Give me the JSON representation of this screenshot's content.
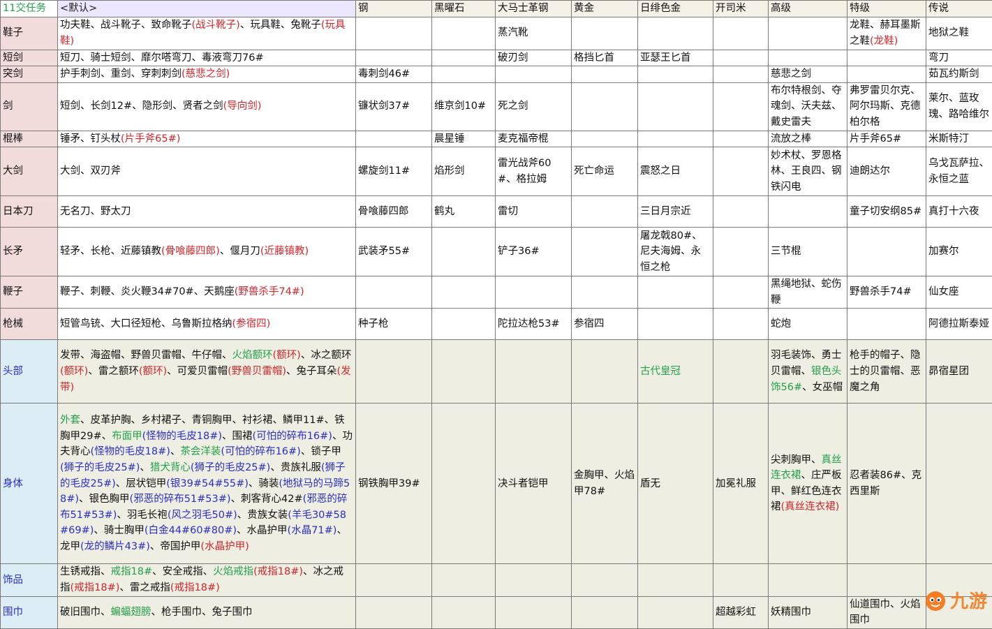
{
  "headers": [
    "11交任务",
    "<默认>",
    "钢",
    "黑曜石",
    "大马士革钢",
    "黄金",
    "日绯色金",
    "开司米",
    "高级",
    "特级",
    "传说"
  ],
  "rows": [
    {
      "label": "鞋子",
      "group": "weapon",
      "height": 47,
      "cells": [
        [
          {
            "t": "功夫鞋、战斗靴子、致命靴子"
          },
          {
            "t": "(战斗靴子)",
            "c": "red"
          },
          {
            "t": "、玩具鞋、兔靴子"
          },
          {
            "t": "(玩具鞋)",
            "c": "red"
          }
        ],
        [],
        [],
        [
          {
            "t": "蒸汽靴"
          }
        ],
        [],
        [],
        [],
        [],
        [
          {
            "t": "龙鞋、赫耳墨斯之鞋"
          },
          {
            "t": "(龙鞋)",
            "c": "red"
          }
        ],
        [
          {
            "t": "地狱之鞋"
          }
        ]
      ]
    },
    {
      "label": "短剑",
      "group": "weapon",
      "height": 23,
      "cells": [
        [
          {
            "t": "短刀、骑士短剑、靡尔嗒弯刀、毒液弯刀76#"
          }
        ],
        [],
        [],
        [
          {
            "t": "破刃剑"
          }
        ],
        [
          {
            "t": "格挡匕首"
          }
        ],
        [
          {
            "t": "亚瑟王匕首"
          }
        ],
        [],
        [],
        [],
        [
          {
            "t": "弯刀"
          }
        ]
      ]
    },
    {
      "label": "突剑",
      "group": "weapon",
      "height": 22,
      "cells": [
        [
          {
            "t": "护手刺剑、重剑、穿刺刺剑"
          },
          {
            "t": "(慈悲之剑)",
            "c": "red"
          }
        ],
        [
          {
            "t": "毒刺剑46#"
          }
        ],
        [],
        [],
        [],
        [],
        [],
        [
          {
            "t": "慈悲之剑"
          }
        ],
        [],
        [
          {
            "t": "茹瓦约斯剑"
          }
        ]
      ]
    },
    {
      "label": "剑",
      "group": "weapon",
      "height": 68,
      "cells": [
        [
          {
            "t": "短剑、长剑12#、隐形剑、贤者之剑"
          },
          {
            "t": "(导向剑)",
            "c": "red"
          }
        ],
        [
          {
            "t": "镰状剑37#"
          }
        ],
        [
          {
            "t": "维京剑10#"
          }
        ],
        [
          {
            "t": "死之剑"
          }
        ],
        [],
        [],
        [],
        [
          {
            "t": "布尔特根剑、夺魂剑、沃夫兹、戴史雷夫"
          }
        ],
        [
          {
            "t": "弗罗雷贝尔克、阿尔玛斯、克德柏尔格"
          }
        ],
        [
          {
            "t": "莱尔、蓝玫瑰、路哈维尔"
          }
        ]
      ]
    },
    {
      "label": "棍棒",
      "group": "weapon",
      "height": 22,
      "cells": [
        [
          {
            "t": "锤矛、钉头杖"
          },
          {
            "t": "(片手斧65#)",
            "c": "red"
          }
        ],
        [],
        [
          {
            "t": "晨星锤"
          }
        ],
        [
          {
            "t": "麦克福帝棍"
          }
        ],
        [],
        [],
        [],
        [
          {
            "t": "流放之棒"
          }
        ],
        [
          {
            "t": "片手斧65#"
          }
        ],
        [
          {
            "t": "米斯特汀"
          }
        ]
      ]
    },
    {
      "label": "大剑",
      "group": "weapon",
      "height": 70,
      "cells": [
        [
          {
            "t": "大剑、双刃斧"
          }
        ],
        [
          {
            "t": "螺旋剑11#"
          }
        ],
        [
          {
            "t": "焰形剑"
          }
        ],
        [
          {
            "t": "雷光战斧60#、格拉姆"
          }
        ],
        [
          {
            "t": "死亡命运"
          }
        ],
        [
          {
            "t": "震怒之日"
          }
        ],
        [],
        [
          {
            "t": "妙术杖、罗恩格林、王良四、钢铁闪电"
          }
        ],
        [
          {
            "t": "迪朗达尔"
          }
        ],
        [
          {
            "t": "乌戈瓦萨拉、永恒之蓝"
          }
        ]
      ]
    },
    {
      "label": "日本刀",
      "group": "weapon",
      "height": 45,
      "cells": [
        [
          {
            "t": "无名刀、野太刀"
          }
        ],
        [
          {
            "t": "骨喰藤四郎"
          }
        ],
        [
          {
            "t": "鹤丸"
          }
        ],
        [
          {
            "t": "雷切"
          }
        ],
        [],
        [
          {
            "t": "三日月宗近"
          }
        ],
        [],
        [],
        [
          {
            "t": "童子切安纲85#"
          }
        ],
        [
          {
            "t": "真打十六夜"
          }
        ]
      ]
    },
    {
      "label": "长矛",
      "group": "weapon",
      "height": 70,
      "cells": [
        [
          {
            "t": "轻矛、长枪、近藤镇教"
          },
          {
            "t": "(骨喰藤四郎)",
            "c": "red"
          },
          {
            "t": "、偃月刀"
          },
          {
            "t": "(近藤镇教)",
            "c": "red"
          }
        ],
        [
          {
            "t": "武装矛55#"
          }
        ],
        [],
        [
          {
            "t": "铲子36#"
          }
        ],
        [],
        [
          {
            "t": "屠龙戟80#、尼夫海姆、永恒之枪"
          }
        ],
        [],
        [
          {
            "t": "三节棍"
          }
        ],
        [],
        [
          {
            "t": "加赛尔"
          }
        ]
      ]
    },
    {
      "label": "鞭子",
      "group": "weapon",
      "height": 45,
      "cells": [
        [
          {
            "t": "鞭子、刺鞭、炎火鞭34#70#、天鹅座"
          },
          {
            "t": "(野兽杀手74#)",
            "c": "red"
          }
        ],
        [],
        [],
        [],
        [],
        [],
        [],
        [
          {
            "t": "黑绳地狱、蛇伤鞭"
          }
        ],
        [
          {
            "t": "野兽杀手74#"
          }
        ],
        [
          {
            "t": "仙女座"
          }
        ]
      ]
    },
    {
      "label": "枪械",
      "group": "weapon",
      "height": 45,
      "cells": [
        [
          {
            "t": "短管鸟铳、大口径短枪、乌鲁斯拉格纳"
          },
          {
            "t": "(参宿四)",
            "c": "red"
          }
        ],
        [
          {
            "t": "种子枪"
          }
        ],
        [],
        [
          {
            "t": "陀拉达枪53#"
          }
        ],
        [
          {
            "t": "参宿四"
          }
        ],
        [],
        [],
        [
          {
            "t": "蛇炮"
          }
        ],
        [],
        [
          {
            "t": "阿德拉斯泰娅"
          }
        ]
      ]
    },
    {
      "label": "头部",
      "group": "armor",
      "height": 91,
      "cells": [
        [
          {
            "t": "发带、海盗帽、野兽贝雷帽、牛仔帽、"
          },
          {
            "t": "火焰额环",
            "c": "green"
          },
          {
            "t": "(额环)",
            "c": "red"
          },
          {
            "t": "、冰之额环"
          },
          {
            "t": "(额环)",
            "c": "red"
          },
          {
            "t": "、雷之额环"
          },
          {
            "t": "(额环)",
            "c": "red"
          },
          {
            "t": "、可爱贝雷帽"
          },
          {
            "t": "(野兽贝雷帽)",
            "c": "red"
          },
          {
            "t": "、兔子耳朵"
          },
          {
            "t": "(发带)",
            "c": "red"
          }
        ],
        [],
        [],
        [],
        [],
        [
          {
            "t": "古代皇冠",
            "c": "green"
          }
        ],
        [],
        [
          {
            "t": "羽毛装饰、勇士贝雷帽、"
          },
          {
            "t": "银色头饰56#",
            "c": "green"
          },
          {
            "t": "、女巫帽"
          }
        ],
        [
          {
            "t": "枪手的帽子、隐士的贝雷帽、恶魔之角"
          }
        ],
        [
          {
            "t": "昴宿星团"
          }
        ]
      ]
    },
    {
      "label": "身体",
      "group": "armor",
      "height": 230,
      "cells": [
        [
          {
            "t": "外套",
            "c": "green"
          },
          {
            "t": "、皮革护胸、乡村裙子、青铜胸甲、衬衫裙、鳞甲11#、铁胸甲29#、"
          },
          {
            "t": "布面甲",
            "c": "green"
          },
          {
            "t": "(怪物的毛皮18#)",
            "c": "blue"
          },
          {
            "t": "、围裙"
          },
          {
            "t": "(可怕的碎布16#)",
            "c": "blue"
          },
          {
            "t": "、功夫背心"
          },
          {
            "t": "(怪物的毛皮18#)",
            "c": "blue"
          },
          {
            "t": "、"
          },
          {
            "t": "茶会洋装",
            "c": "green"
          },
          {
            "t": "(可怕的碎布16#)",
            "c": "blue"
          },
          {
            "t": "、锁子甲"
          },
          {
            "t": "(狮子的毛皮25#)",
            "c": "blue"
          },
          {
            "t": "、"
          },
          {
            "t": "猎犬背心",
            "c": "green"
          },
          {
            "t": "(狮子的毛皮25#)",
            "c": "blue"
          },
          {
            "t": "、贵族礼服"
          },
          {
            "t": "(狮子的毛皮25#)",
            "c": "blue"
          },
          {
            "t": "、层状铠甲"
          },
          {
            "t": "(银39#54#55#)",
            "c": "blue"
          },
          {
            "t": "、骑装"
          },
          {
            "t": "(地狱马的马蹄58#)",
            "c": "blue"
          },
          {
            "t": "、银色胸甲"
          },
          {
            "t": "(邪恶的碎布51#53#)",
            "c": "blue"
          },
          {
            "t": "、刺客背心42#"
          },
          {
            "t": "(邪恶的碎布51#53#)",
            "c": "blue"
          },
          {
            "t": "、羽毛长袍"
          },
          {
            "t": "(风之羽毛50#)",
            "c": "blue"
          },
          {
            "t": "、贵族女装"
          },
          {
            "t": "(羊毛30#58#69#)",
            "c": "blue"
          },
          {
            "t": "、骑士胸甲"
          },
          {
            "t": "(白金44#60#80#)",
            "c": "blue"
          },
          {
            "t": "、水晶护甲"
          },
          {
            "t": "(水晶71#)",
            "c": "blue"
          },
          {
            "t": "、龙甲"
          },
          {
            "t": "(龙的鳞片43#)",
            "c": "blue"
          },
          {
            "t": "、帝国护甲"
          },
          {
            "t": "(水晶护甲)",
            "c": "red"
          }
        ],
        [
          {
            "t": "钢铁胸甲39#"
          }
        ],
        [],
        [
          {
            "t": "决斗者铠甲"
          }
        ],
        [
          {
            "t": "金胸甲、火焰甲78#"
          }
        ],
        [
          {
            "t": "盾无"
          }
        ],
        [
          {
            "t": "加冕礼服"
          }
        ],
        [
          {
            "t": "尖刺胸甲、"
          },
          {
            "t": "真丝连衣裙",
            "c": "green"
          },
          {
            "t": "、庄严板甲、鲜红色连衣裙"
          },
          {
            "t": "(真丝连衣裙)",
            "c": "red"
          }
        ],
        [
          {
            "t": "忍者装86#、克西里斯"
          }
        ],
        []
      ]
    },
    {
      "label": "饰品",
      "group": "armor",
      "height": 46,
      "cells": [
        [
          {
            "t": "生锈戒指、"
          },
          {
            "t": "戒指18#",
            "c": "green"
          },
          {
            "t": "、安全戒指、"
          },
          {
            "t": "火焰戒指",
            "c": "green"
          },
          {
            "t": "(戒指18#)",
            "c": "red"
          },
          {
            "t": "、冰之戒指"
          },
          {
            "t": "(戒指18#)",
            "c": "red"
          },
          {
            "t": "、雷之戒指"
          },
          {
            "t": "(戒指18#)",
            "c": "red"
          }
        ],
        [],
        [],
        [],
        [],
        [],
        [],
        [],
        [],
        []
      ]
    },
    {
      "label": "围巾",
      "group": "armor",
      "height": 45,
      "cells": [
        [
          {
            "t": "破旧围巾、"
          },
          {
            "t": "蝙蝠翅膀",
            "c": "green"
          },
          {
            "t": "、枪手围巾、兔子围巾"
          }
        ],
        [],
        [],
        [],
        [],
        [],
        [
          {
            "t": "超越彩虹"
          }
        ],
        [
          {
            "t": "妖精围巾"
          }
        ],
        [
          {
            "t": "仙道围巾、火焰围巾"
          }
        ],
        []
      ]
    }
  ],
  "logo": {
    "text": "九游"
  }
}
